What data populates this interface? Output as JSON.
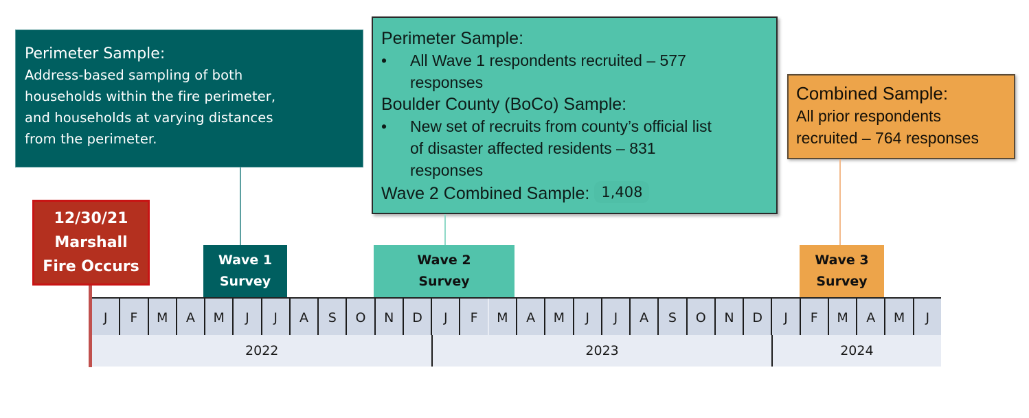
{
  "wave1_description": {
    "title": "Perimeter Sample:",
    "lines": [
      "Address-based sampling of both",
      "households within the fire perimeter,",
      "and households at varying distances",
      "from the perimeter."
    ],
    "color": "#005f60"
  },
  "wave2_description": {
    "perimeter_title": "Perimeter Sample:",
    "perimeter_bullet_line1": "All Wave 1 respondents recruited – 577",
    "perimeter_bullet_line2": "responses",
    "boco_title": "Boulder County (BoCo) Sample:",
    "boco_bullet_line1": "New set of recruits from county’s official list",
    "boco_bullet_line2": "of disaster affected residents – 831",
    "boco_bullet_line3": "responses",
    "combined_label": "Wave 2 Combined Sample:",
    "combined_value": "1,408",
    "bullet_glyph": "•",
    "color": "#52c3ab"
  },
  "wave3_description": {
    "title": "Combined Sample:",
    "line1": "All prior respondents",
    "line2": "recruited – 764 responses",
    "color": "#eda44a"
  },
  "event": {
    "date": "12/30/21",
    "line2": "Marshall",
    "line3": "Fire Occurs",
    "color": "#b4301f"
  },
  "waves": [
    {
      "line1": "Wave 1",
      "line2": "Survey"
    },
    {
      "line1": "Wave 2",
      "line2": "Survey"
    },
    {
      "line1": "Wave 3",
      "line2": "Survey"
    }
  ],
  "timeline": {
    "months": [
      "J",
      "F",
      "M",
      "A",
      "M",
      "J",
      "J",
      "A",
      "S",
      "O",
      "N",
      "D",
      "J",
      "F",
      "M",
      "A",
      "M",
      "J",
      "J",
      "A",
      "S",
      "O",
      "N",
      "D",
      "J",
      "F",
      "M",
      "A",
      "M",
      "J"
    ],
    "years": [
      {
        "label": "2022",
        "months": 12
      },
      {
        "label": "2023",
        "months": 12
      },
      {
        "label": "2024",
        "months": 6
      }
    ]
  }
}
